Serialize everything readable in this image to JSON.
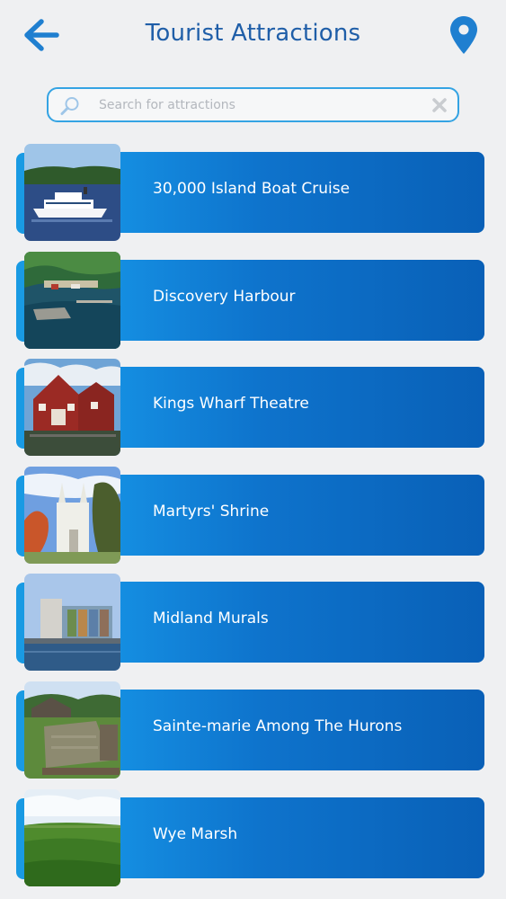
{
  "header": {
    "title": "Tourist Attractions",
    "back_icon": "arrow-left-icon",
    "map_icon": "map-pin-icon",
    "accent_color": "#1f7fd0"
  },
  "search": {
    "placeholder": "Search for attractions",
    "value": "",
    "border_color": "#34a3e3"
  },
  "attractions": [
    {
      "name": "30,000 Island Boat Cruise"
    },
    {
      "name": "Discovery Harbour"
    },
    {
      "name": "Kings Wharf Theatre"
    },
    {
      "name": "Martyrs' Shrine"
    },
    {
      "name": "Midland Murals"
    },
    {
      "name": "Sainte-marie Among The Hurons"
    },
    {
      "name": "Wye Marsh"
    }
  ]
}
